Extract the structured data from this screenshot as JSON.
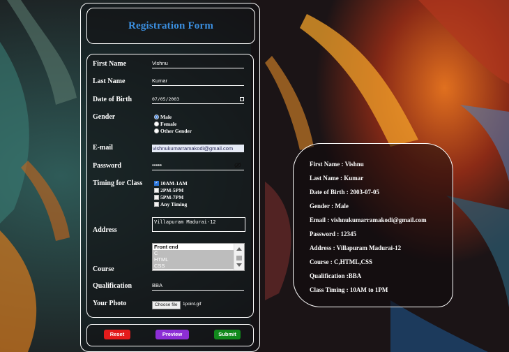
{
  "form": {
    "title": "Registration Form",
    "first_name_label": "First Name",
    "first_name_value": "Vishnu",
    "last_name_label": "Last Name",
    "last_name_value": "Kumar",
    "dob_label": "Date of Birth",
    "dob_value": "07/05/2003",
    "gender_label": "Gender",
    "gender_options": [
      "Male",
      "Female",
      "Other Gender"
    ],
    "gender_selected": "Male",
    "email_label": "E-mail",
    "email_value": "vishnukumarramakodi@gmail.com",
    "password_label": "Password",
    "password_value": "•••••",
    "timing_label": "Timing for Class",
    "timing_options": [
      "10AM-1AM",
      "2PM-5PM",
      "5PM-7PM",
      "Any Timing"
    ],
    "timing_checked": [
      "10AM-1AM"
    ],
    "address_label": "Address",
    "address_value": "Villapuram Madurai-12",
    "course_label": "Course",
    "course_options": [
      "Front end",
      "C",
      "HTML",
      "CSS"
    ],
    "qualification_label": "Qualification",
    "qualification_value": "BBA",
    "photo_label": "Your Photo",
    "file_button": "Choose file",
    "file_name": "1point.gif"
  },
  "buttons": {
    "reset": "Reset",
    "preview": "Preview",
    "submit": "Submit"
  },
  "preview_card": {
    "lines": [
      "First Name   : Vishnu",
      "Last Name    : Kumar",
      "Date of Birth : 2003-07-05",
      "Gender          : Male",
      "Email             : vishnukumarramakodi@gmail.com",
      "Password      : 12345",
      "Address         : Villapuram Madurai-12",
      "Course           : C,HTML,CSS",
      "Qualification  :BBA",
      "Class Timing  : 10AM to 1PM"
    ]
  },
  "colors": {
    "title": "#3b8fe0",
    "reset": "#e41b1b",
    "preview": "#8c2ed6",
    "submit": "#118a1c"
  }
}
